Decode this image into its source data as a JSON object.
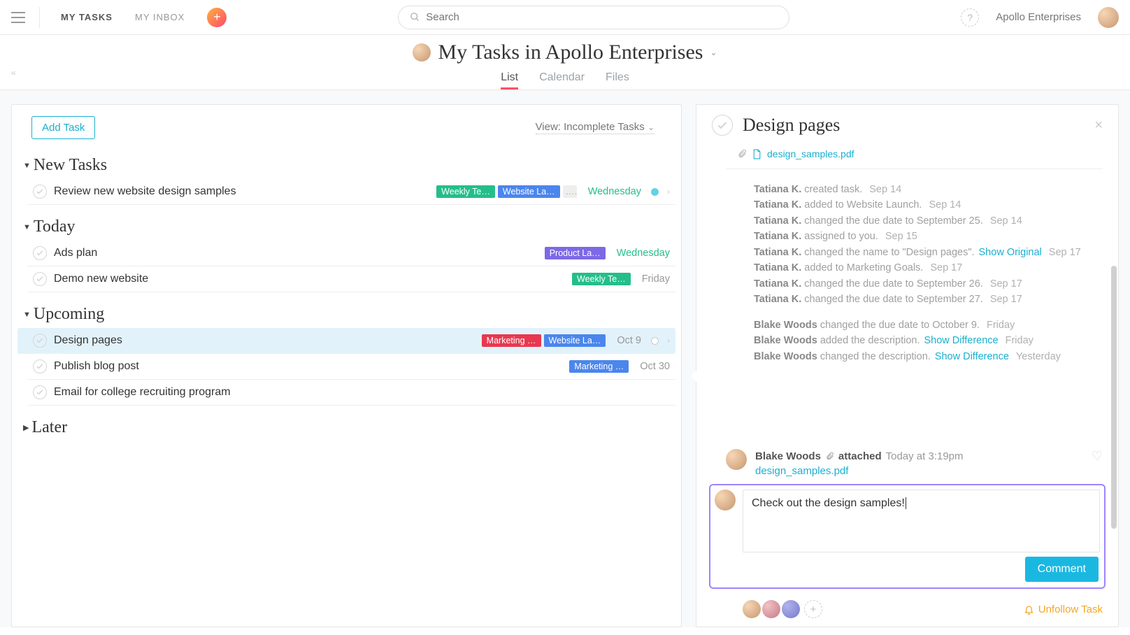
{
  "topbar": {
    "nav": {
      "my_tasks": "MY TASKS",
      "my_inbox": "MY INBOX"
    },
    "search_placeholder": "Search",
    "org": "Apollo Enterprises",
    "help": "?"
  },
  "header": {
    "title": "My Tasks in Apollo Enterprises",
    "tabs": {
      "list": "List",
      "calendar": "Calendar",
      "files": "Files"
    }
  },
  "left": {
    "add_task": "Add Task",
    "view_filter": "View: Incomplete Tasks",
    "sections": {
      "new_tasks": "New Tasks",
      "today": "Today",
      "upcoming": "Upcoming",
      "later": "Later"
    },
    "tasks": {
      "t1": {
        "name": "Review new website design samples",
        "due": "Wednesday",
        "tags": {
          "a": "Weekly Te…",
          "b": "Website La…",
          "c": "…"
        }
      },
      "t2": {
        "name": "Ads plan",
        "due": "Wednesday",
        "tags": {
          "a": "Product La…"
        }
      },
      "t3": {
        "name": "Demo new website",
        "due": "Friday",
        "tags": {
          "a": "Weekly Te…"
        }
      },
      "t4": {
        "name": "Design pages",
        "due": "Oct 9",
        "tags": {
          "a": "Marketing …",
          "b": "Website La…"
        }
      },
      "t5": {
        "name": "Publish blog post",
        "due": "Oct 30",
        "tags": {
          "a": "Marketing …"
        }
      },
      "t6": {
        "name": "Email for college recruiting program"
      }
    }
  },
  "detail": {
    "title": "Design pages",
    "attachment": "design_samples.pdf",
    "activity": {
      "g1": {
        "l1": {
          "who": "Tatiana K.",
          "what": "created task.",
          "date": "Sep 14"
        },
        "l2": {
          "who": "Tatiana K.",
          "what": "added to Website Launch.",
          "date": "Sep 14"
        },
        "l3": {
          "who": "Tatiana K.",
          "what": "changed the due date to September 25.",
          "date": "Sep 14"
        },
        "l4": {
          "who": "Tatiana K.",
          "what": "assigned to you.",
          "date": "Sep 15"
        },
        "l5": {
          "who": "Tatiana K.",
          "what": "changed the name to \"Design pages\".",
          "link": "Show Original",
          "date": "Sep 17"
        },
        "l6": {
          "who": "Tatiana K.",
          "what": "added to Marketing Goals.",
          "date": "Sep 17"
        },
        "l7": {
          "who": "Tatiana K.",
          "what": "changed the due date to September 26.",
          "date": "Sep 17"
        },
        "l8": {
          "who": "Tatiana K.",
          "what": "changed the due date to September 27.",
          "date": "Sep 17"
        }
      },
      "g2": {
        "l1": {
          "who": "Blake Woods",
          "what": "changed the due date to October 9.",
          "date": "Friday"
        },
        "l2": {
          "who": "Blake Woods",
          "what": "added the description.",
          "link": "Show Difference",
          "date": "Friday"
        },
        "l3": {
          "who": "Blake Woods",
          "what": "changed the description.",
          "link": "Show Difference",
          "date": "Yesterday"
        }
      }
    },
    "comment": {
      "who": "Blake Woods",
      "action": "attached",
      "time": "Today at 3:19pm",
      "file": "design_samples.pdf"
    },
    "compose": {
      "text": "Check out the design samples!",
      "button": "Comment"
    },
    "unfollow": "Unfollow Task"
  }
}
